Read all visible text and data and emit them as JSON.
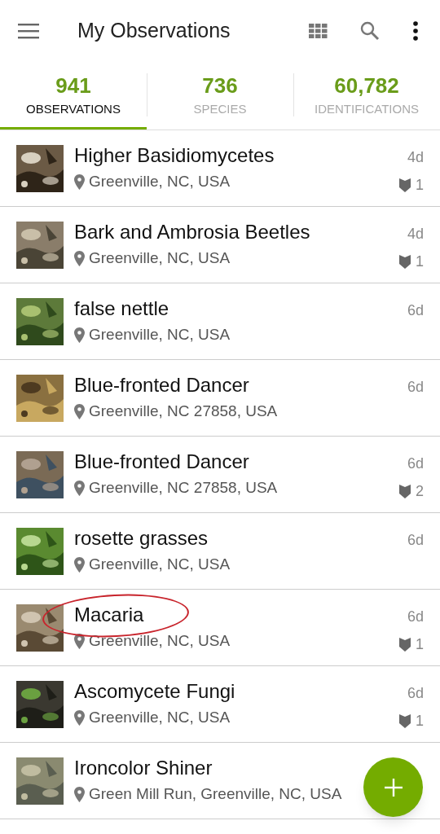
{
  "toolbar": {
    "title": "My Observations"
  },
  "tabs": [
    {
      "count": "941",
      "label": "OBSERVATIONS",
      "selected": true
    },
    {
      "count": "736",
      "label": "SPECIES",
      "selected": false
    },
    {
      "count": "60,782",
      "label": "IDENTIFICATIONS",
      "selected": false
    }
  ],
  "observations": [
    {
      "name": "Higher Basidiomycetes",
      "place": "Greenville, NC, USA",
      "time": "4d",
      "ids": "1",
      "circled": false
    },
    {
      "name": "Bark and Ambrosia Beetles",
      "place": "Greenville, NC, USA",
      "time": "4d",
      "ids": "1",
      "circled": false
    },
    {
      "name": "false nettle",
      "place": "Greenville, NC, USA",
      "time": "6d",
      "circled": false
    },
    {
      "name": "Blue-fronted Dancer",
      "place": "Greenville, NC 27858, USA",
      "time": "6d",
      "circled": false
    },
    {
      "name": "Blue-fronted Dancer",
      "place": "Greenville, NC 27858, USA",
      "time": "6d",
      "ids": "2",
      "circled": false
    },
    {
      "name": "rosette grasses",
      "place": "Greenville, NC, USA",
      "time": "6d",
      "circled": false
    },
    {
      "name": "Macaria",
      "place": "Greenville, NC, USA",
      "time": "6d",
      "ids": "1",
      "circled": true
    },
    {
      "name": "Ascomycete Fungi",
      "place": "Greenville, NC, USA",
      "time": "6d",
      "ids": "1",
      "circled": false
    },
    {
      "name": "Ironcolor Shiner",
      "place": "Green Mill Run, Greenville, NC, USA",
      "circled": false
    }
  ]
}
